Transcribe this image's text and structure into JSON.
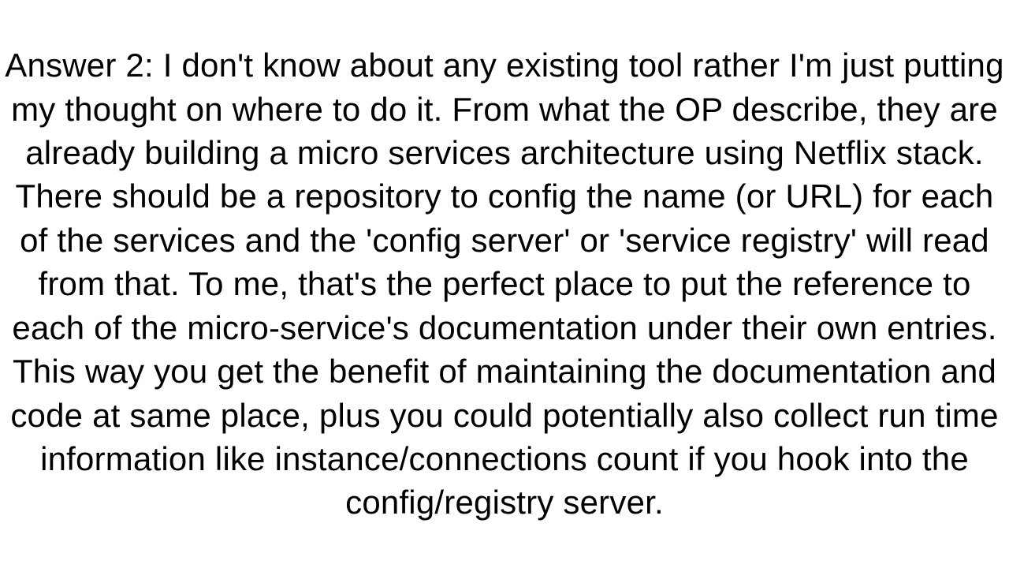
{
  "answer": {
    "text": "Answer 2: I don't know about any existing tool rather I'm just putting my thought on where to do it. From what the OP describe, they are already building a micro services architecture using Netflix stack. There should be a repository to config the name (or URL) for each of the services and the 'config server' or 'service registry' will read from that. To me, that's the perfect place to put the reference to each of the micro-service's documentation under their own entries. This way you get the benefit of maintaining the documentation and code at same place, plus you could potentially also collect run time information like instance/connections count if you hook into the config/registry server."
  }
}
